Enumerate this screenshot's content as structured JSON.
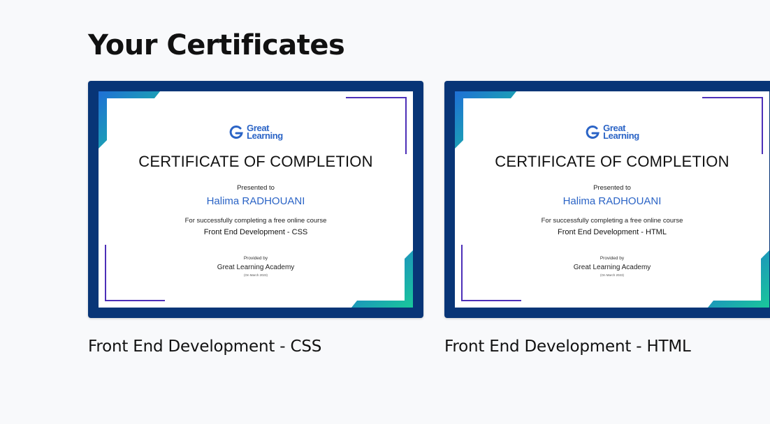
{
  "page": {
    "title": "Your Certificates"
  },
  "colors": {
    "frame": "#083577",
    "accent_blue": "#2b64c6",
    "line_purple": "#4c2fb8",
    "gradient_start": "#1f6fd6",
    "gradient_end": "#19c79a"
  },
  "certificates": [
    {
      "logo_line1": "Great",
      "logo_line2": "Learning",
      "heading": "CERTIFICATE OF COMPLETION",
      "presented_to": "Presented to",
      "recipient": "Halima RADHOUANI",
      "for_text": "For successfully completing a free online course",
      "course": "Front End Development - CSS",
      "provided_by": "Provided by",
      "academy": "Great Learning Academy",
      "date": "(On March 2023)",
      "caption": "Front End Development - CSS"
    },
    {
      "logo_line1": "Great",
      "logo_line2": "Learning",
      "heading": "CERTIFICATE OF COMPLETION",
      "presented_to": "Presented to",
      "recipient": "Halima RADHOUANI",
      "for_text": "For successfully completing a free online course",
      "course": "Front End Development - HTML",
      "provided_by": "Provided by",
      "academy": "Great Learning Academy",
      "date": "(On March 2023)",
      "caption": "Front End Development - HTML"
    }
  ]
}
